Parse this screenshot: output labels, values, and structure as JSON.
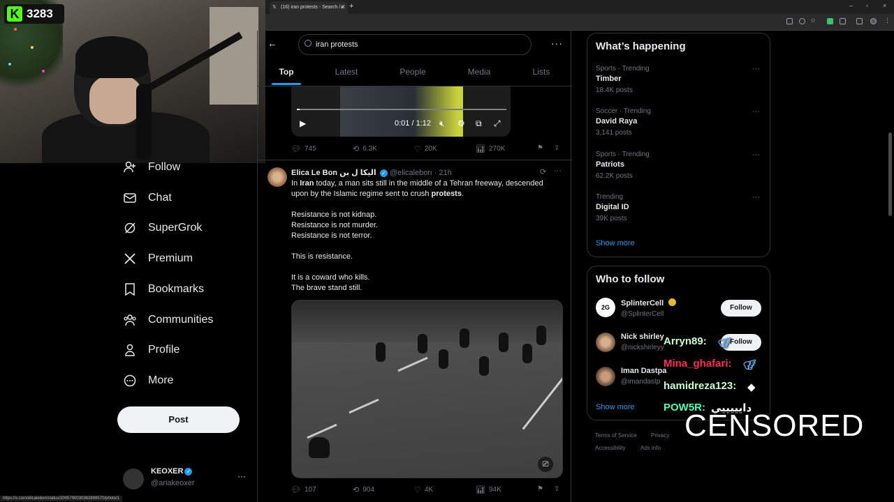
{
  "browser": {
    "tab_title": "(16) iran protests - Search / X",
    "tab_close": "×",
    "new_tab": "+",
    "window_controls": [
      "–",
      "▫",
      "×"
    ]
  },
  "stream": {
    "kick_logo": "K",
    "viewer_count": "3283"
  },
  "sidebar": {
    "items": [
      {
        "label": "Follow",
        "icon": "add-person-icon"
      },
      {
        "label": "Chat",
        "icon": "mail-icon"
      },
      {
        "label": "SuperGrok",
        "icon": "grok-icon"
      },
      {
        "label": "Premium",
        "icon": "x-logo-icon"
      },
      {
        "label": "Bookmarks",
        "icon": "bookmark-icon"
      },
      {
        "label": "Communities",
        "icon": "people-icon"
      },
      {
        "label": "Profile",
        "icon": "person-icon"
      },
      {
        "label": "More",
        "icon": "more-circle-icon"
      }
    ],
    "post_label": "Post",
    "account": {
      "name": "KEOXER",
      "handle": "@ariakeoxer",
      "more": "···"
    }
  },
  "search": {
    "query": "iran protests",
    "more": "···",
    "tabs": [
      "Top",
      "Latest",
      "People",
      "Media",
      "Lists"
    ],
    "active_tab": "Top"
  },
  "video": {
    "time": "0:01 / 1:12",
    "progress": 0.014
  },
  "tweet1_actions": {
    "replies": "745",
    "reposts": "6.3K",
    "likes": "20K",
    "views": "270K"
  },
  "tweet2": {
    "name": "Elica Le Bon",
    "name_ar": "الیکا ل بن",
    "handle": "@elicalebon",
    "time": "· 21h",
    "more": "···",
    "body_line1_pre": "In ",
    "body_line1_bold": "Iran",
    "body_line1_post": " today, a man sits still in the middle of a Tehran freeway, descended",
    "body_line2_pre": "upon by the Islamic regime sent to crush ",
    "body_line2_bold": "protests",
    "body_line2_post": ".",
    "lines": [
      "Resistance is not kidnap.",
      "Resistance is not murder.",
      "Resistance is not terror.",
      "This is resistance.",
      "It is a coward who kills.",
      "The brave stand still."
    ],
    "actions": {
      "replies": "107",
      "reposts": "904",
      "likes": "4K",
      "views": "94K"
    }
  },
  "whats_happening": {
    "title": "What’s happening",
    "trends": [
      {
        "meta": "Sports · Trending",
        "name": "Timber",
        "count": "18.4K posts"
      },
      {
        "meta": "Soccer · Trending",
        "name": "David Raya",
        "count": "3,141 posts"
      },
      {
        "meta": "Sports · Trending",
        "name": "Patriots",
        "count": "62.2K posts"
      },
      {
        "meta": "Trending",
        "name": "Digital ID",
        "count": "39K posts"
      }
    ],
    "dots": "···",
    "show_more": "Show more"
  },
  "who_to_follow": {
    "title": "Who to follow",
    "users": [
      {
        "name": "SplinterCell",
        "handle": "@SplinterCell",
        "follow": "Follow"
      },
      {
        "name": "Nick shirley",
        "handle": "@nickshirleyy",
        "follow": "Follow"
      },
      {
        "name": "Iman Dastpa",
        "handle": "@imandastp",
        "follow": ""
      }
    ],
    "show_more": "Show more"
  },
  "footer": {
    "links": [
      "Terms of Service",
      "Privacy",
      "Accessibility",
      "Ads info"
    ]
  },
  "chat": [
    {
      "user": "Arryn89:",
      "color": "#c8ffd1"
    },
    {
      "user": "Mina_ghafari:",
      "color": "#ff2b5a"
    },
    {
      "user": "hamidreza123:",
      "color": "#c8ffd1"
    },
    {
      "user": "POW5R:",
      "msg": "دايييييي",
      "color": "#4dffb0"
    }
  ],
  "censored": "CENSORED",
  "status_url": "https://x.com/elicalebon/status/2005790030362898570/photo/1"
}
